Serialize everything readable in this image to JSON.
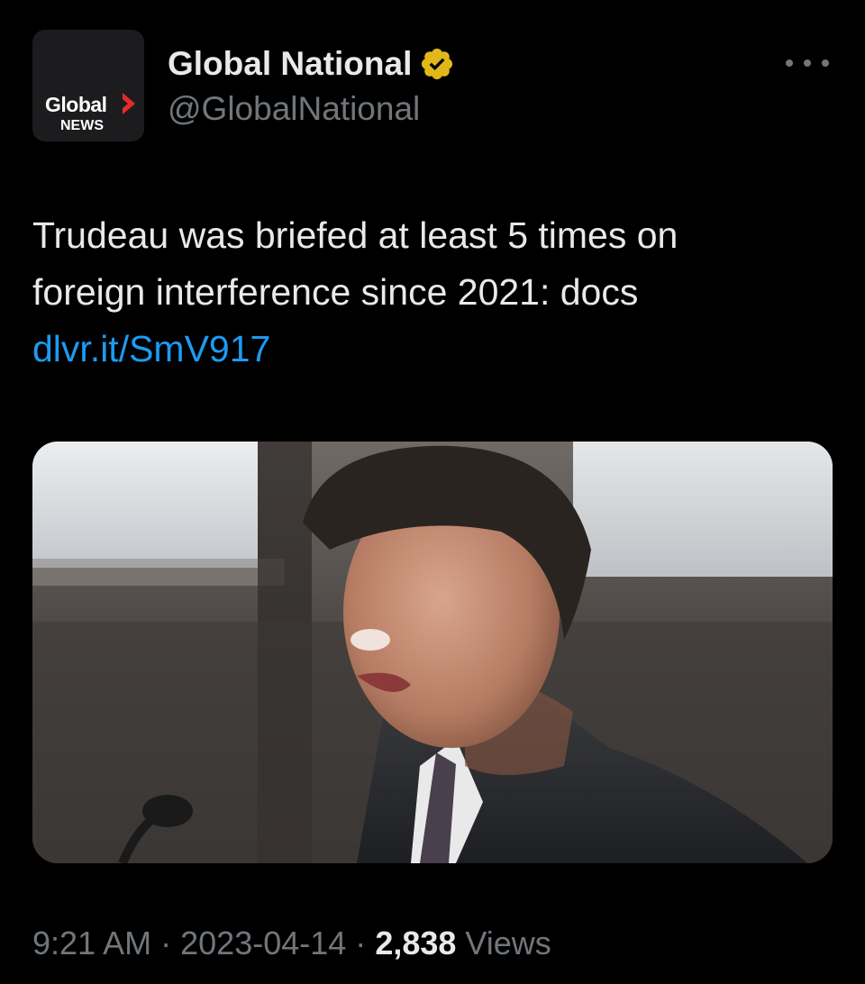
{
  "account": {
    "avatar_brand": "Global",
    "avatar_brand_sub": "NEWS",
    "display_name": "Global National",
    "handle": "@GlobalNational",
    "verified_badge_color": "#e2b719"
  },
  "tweet": {
    "text_line1": "Trudeau was briefed at least 5 times on",
    "text_line2": "foreign interference since 2021: docs",
    "link": "dlvr.it/SmV917",
    "time": "9:21 AM",
    "separator": "·",
    "date": "2023-04-14",
    "views_count": "2,838",
    "views_label": "Views"
  },
  "icons": {
    "more": "more-horizontal-icon",
    "verified": "verified-badge-icon",
    "logo_arrow": "global-news-arrow-logo"
  },
  "colors": {
    "background": "#000000",
    "text_primary": "#e7e9ea",
    "text_secondary": "#71767b",
    "link": "#1d9bf0",
    "logo_red": "#e32b2b"
  }
}
